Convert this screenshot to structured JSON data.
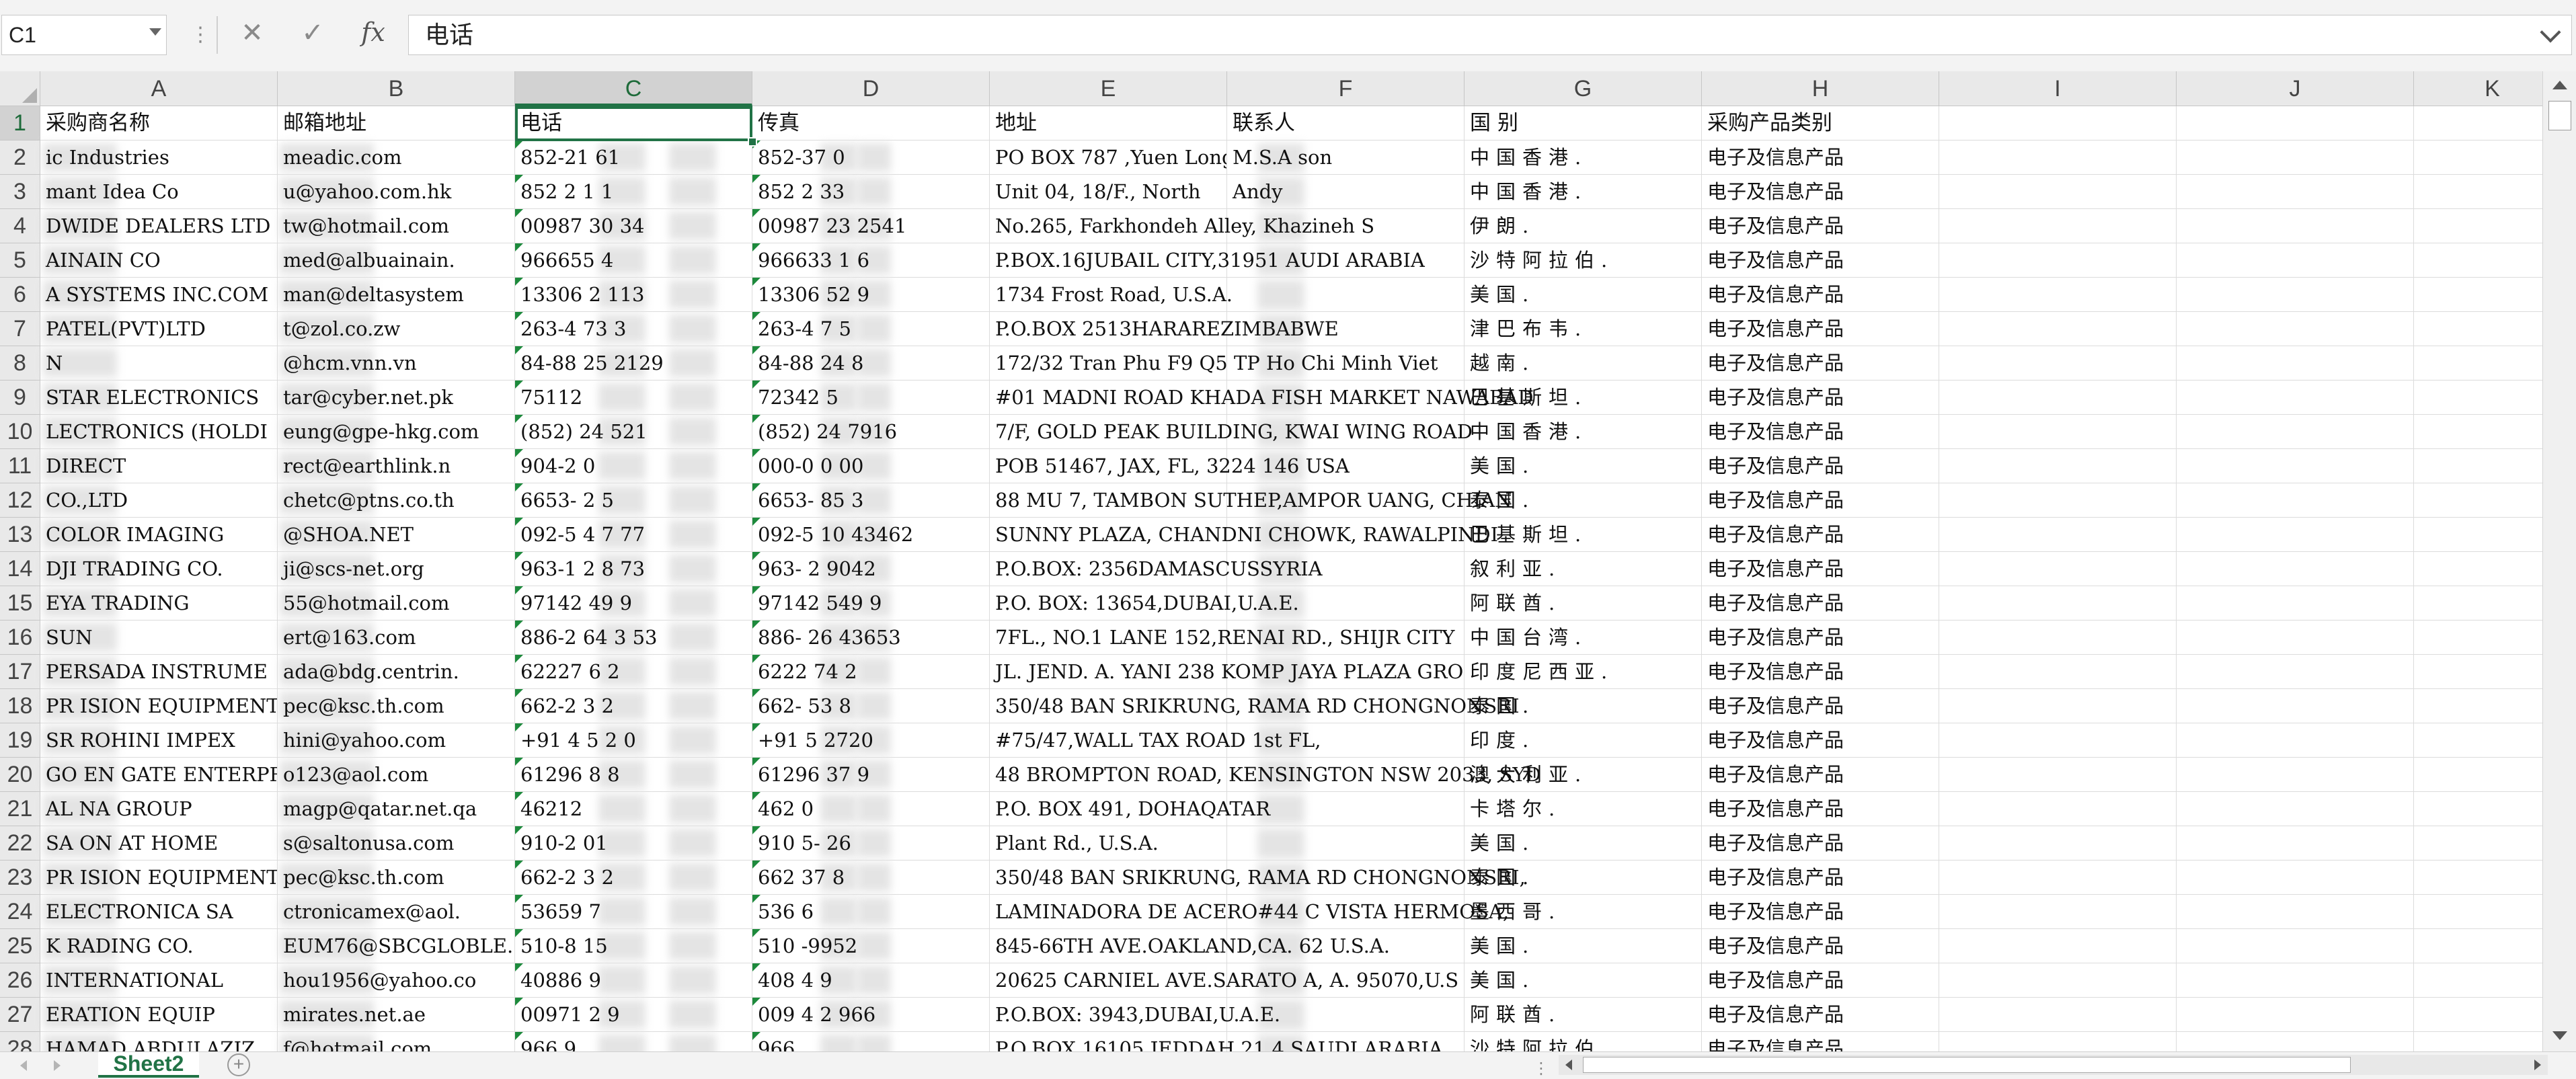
{
  "formula_bar": {
    "name_box": "C1",
    "cancel_icon": "close-icon",
    "enter_icon": "check-icon",
    "fx_label": "fx",
    "value": "电话"
  },
  "columns": [
    "A",
    "B",
    "C",
    "D",
    "E",
    "F",
    "G",
    "H",
    "I",
    "J",
    "K"
  ],
  "selected_column": "C",
  "selected_row": "1",
  "rows": [
    {
      "n": "1",
      "cells": [
        "采购商名称",
        "邮箱地址",
        "电话",
        "传真",
        "地址",
        "联系人",
        "国别",
        "采购产品类别"
      ]
    },
    {
      "n": "2",
      "cells": [
        "     ic Industries",
        "      meadic.com",
        "852-21    61",
        "852-37      0",
        "PO BOX 787 ,Yuen Long",
        "M.S.A    son",
        "中国香港.",
        "电子及信息产品"
      ]
    },
    {
      "n": "3",
      "cells": [
        "     mant Idea Co",
        "      u@yahoo.com.hk",
        "852 2     1  1",
        "852 2      33",
        "Unit 04, 18/F., North",
        "Andy     ",
        "中国香港.",
        "电子及信息产品"
      ]
    },
    {
      "n": "4",
      "cells": [
        "     DWIDE DEALERS LTD",
        "      tw@hotmail.com",
        "00987   30   34",
        "00987   23  2541",
        "No.265, Farkhondeh Alley, Khazineh S",
        "",
        "伊朗.",
        "电子及信息产品"
      ]
    },
    {
      "n": "5",
      "cells": [
        "     AINAIN CO",
        "      med@albuainain.",
        "966655    4",
        "966633     1  6",
        "P.BOX.16JUBAIL CITY,31951 AUDI ARABIA",
        "",
        "沙特阿拉伯.",
        "电子及信息产品"
      ]
    },
    {
      "n": "6",
      "cells": [
        "     A SYSTEMS INC.COM",
        "      man@deltasystem",
        "13306    2   113",
        "13306     52  9",
        "1734 Frost Road, U.S.A.",
        "",
        "美国.",
        "电子及信息产品"
      ]
    },
    {
      "n": "7",
      "cells": [
        "     PATEL(PVT)LTD",
        "      t@zol.co.zw",
        "263-4   73   3",
        "263-4   7   5",
        "P.O.BOX 2513HARAREZIMBABWE",
        "",
        "津巴布韦.",
        "电子及信息产品"
      ]
    },
    {
      "n": "8",
      "cells": [
        "     N",
        "      @hcm.vnn.vn",
        "84-88   25  2129",
        "84-88   24   8",
        "172/32 Tran Phu F9 Q5 TP Ho Chi Minh Viet",
        "",
        "越南.",
        "电子及信息产品"
      ]
    },
    {
      "n": "9",
      "cells": [
        "     STAR ELECTRONICS",
        "      tar@cyber.net.pk",
        "75112",
        "72342   5",
        "#01 MADNI ROAD KHADA FISH MARKET NAWABAD",
        "",
        "巴基斯坦.",
        "电子及信息产品"
      ]
    },
    {
      "n": "10",
      "cells": [
        "     LECTRONICS (HOLDI",
        "      eung@gpe-hkg.com",
        "(852)   24   521",
        "(852)   24   7916",
        "7/F, GOLD PEAK BUILDING,   KWAI WING ROAD",
        "",
        "中国香港.",
        "电子及信息产品"
      ]
    },
    {
      "n": "11",
      "cells": [
        "     DIRECT",
        "      rect@earthlink.n",
        "904-2       0",
        "000-0    0  00",
        "POB 51467, JAX, FL, 3224  146   USA",
        "",
        "美国.",
        "电子及信息产品"
      ]
    },
    {
      "n": "12",
      "cells": [
        "     CO.,LTD",
        "      chetc@ptns.co.th",
        "6653-    2   5",
        "6653-    85   3",
        "88 MU 7, TAMBON SUTHEP,AMPOR  UANG, CHIAN",
        "",
        "泰国.",
        "电子及信息产品"
      ]
    },
    {
      "n": "13",
      "cells": [
        "     COLOR IMAGING",
        "      @SHOA.NET",
        "092-5    4   7  77",
        "092-5   10  43462",
        "SUNNY PLAZA, CHANDNI CHOWK, RAWALPINDI",
        "",
        "巴基斯坦.",
        "电子及信息产品"
      ]
    },
    {
      "n": "14",
      "cells": [
        "     DJI TRADING CO.",
        "      ji@scs-net.org",
        "963-1   2   8  73",
        "963-    2  9042",
        "P.O.BOX: 2356DAMASCUSSYRIA",
        "",
        "叙利亚.",
        "电子及信息产品"
      ]
    },
    {
      "n": "15",
      "cells": [
        "     EYA TRADING",
        "      55@hotmail.com",
        "97142    49   9",
        "97142   549  9",
        "P.O. BOX: 13654,DUBAI,U.A.E.",
        "",
        "阿联酋.",
        "电子及信息产品"
      ]
    },
    {
      "n": "16",
      "cells": [
        "     SUN",
        "      ert@163.com",
        "886-2   64   3  53",
        "886-    26  43653",
        "7FL., NO.1 LANE 152,RENAI RD., SHIJR CITY",
        "",
        "中国台湾.",
        "电子及信息产品"
      ]
    },
    {
      "n": "17",
      "cells": [
        "     PERSADA INSTRUME",
        "      ada@bdg.centrin.",
        "62227    6   2",
        "6222    74   2",
        "JL. JEND. A. YANI 238 KOMP JAYA PLAZA GRO",
        "",
        "印度尼西亚.",
        "电子及信息产品"
      ]
    },
    {
      "n": "18",
      "cells": [
        "PR   ISION EQUIPMENT C",
        "      pec@ksc.th.com",
        "662-2     3   2",
        "662-    53   8",
        "350/48 BAN SRIKRUNG, RAMA  RD CHONGNONSRI",
        "",
        "泰国.",
        "电子及信息产品"
      ]
    },
    {
      "n": "19",
      "cells": [
        "SR   ROHINI IMPEX",
        "      hini@yahoo.com",
        "+91 4   5   2  0",
        "+91    5   2720",
        "#75/47,WALL TAX ROAD 1st FL,",
        "",
        "印度.",
        "电子及信息产品"
      ]
    },
    {
      "n": "20",
      "cells": [
        "GO   EN GATE ENTERPRIS",
        "      o123@aol.com",
        "61296    8   8",
        "61296   37   9",
        "48 BROMPTON ROAD, KENSINGTON NSW 2033, SYD",
        "",
        "澳大利亚.",
        "电子及信息产品"
      ]
    },
    {
      "n": "21",
      "cells": [
        "AL   NA GROUP",
        "      magp@qatar.net.qa",
        "46212",
        "462     0",
        "P.O. BOX 491, DOHAQATAR",
        "",
        "卡塔尔.",
        "电子及信息产品"
      ]
    },
    {
      "n": "22",
      "cells": [
        "SA   ON AT HOME",
        "      s@saltonusa.com",
        "910-2     01",
        "910     5-  26",
        " Plant Rd., U.S.A.",
        "",
        "美国.",
        "电子及信息产品"
      ]
    },
    {
      "n": "23",
      "cells": [
        "PR   ISION EQUIPMENT",
        "      pec@ksc.th.com",
        "662-2    3   2",
        "662     37   8",
        "350/48 BAN SRIKRUNG, RAMA  RD CHONGNONSRI,",
        "",
        "泰国.",
        "电子及信息产品"
      ]
    },
    {
      "n": "24",
      "cells": [
        "    ELECTRONICA SA",
        "      ctronicamex@aol.",
        "53659    7",
        "536      6",
        "LAMINADORA DE ACERO#44 C   VISTA HERMOSA,",
        "",
        "墨西哥.",
        "电子及信息产品"
      ]
    },
    {
      "n": "25",
      "cells": [
        "K   RADING CO.",
        "      EUM76@SBCGLOBLE.",
        "510-8     15",
        "510     -9952",
        "845-66TH AVE.OAKLAND,CA.   62  U.S.A.",
        "",
        "美国.",
        "电子及信息产品"
      ]
    },
    {
      "n": "26",
      "cells": [
        "    INTERNATIONAL",
        "      hou1956@yahoo.co",
        "40886     9",
        "408     4  9",
        "20625 CARNIEL AVE.SARATO  A,  A. 95070,U.S",
        "",
        "美国.",
        "电子及信息产品"
      ]
    },
    {
      "n": "27",
      "cells": [
        "    ERATION EQUIP",
        "      mirates.net.ae",
        "00971    2  9",
        "009    4  2  966",
        "P.O.BOX: 3943,DUBAI,U.A.E.",
        "",
        "阿联酋.",
        "电子及信息产品"
      ]
    },
    {
      "n": "28",
      "cells": [
        "    HAMAD ABDULAZIZ",
        "      f@hotmail.com",
        "966    9",
        "966",
        "P.O.BOX 16105 JEDDAH 21  4 SAUDI ARABIA",
        "",
        "沙特阿拉伯.",
        "电子及信息产品"
      ]
    }
  ],
  "sheet_tab": "Sheet2",
  "colors": {
    "accent": "#217346",
    "header_bg": "#e9e9e9",
    "selected_header_bg": "#d2d2d2"
  }
}
